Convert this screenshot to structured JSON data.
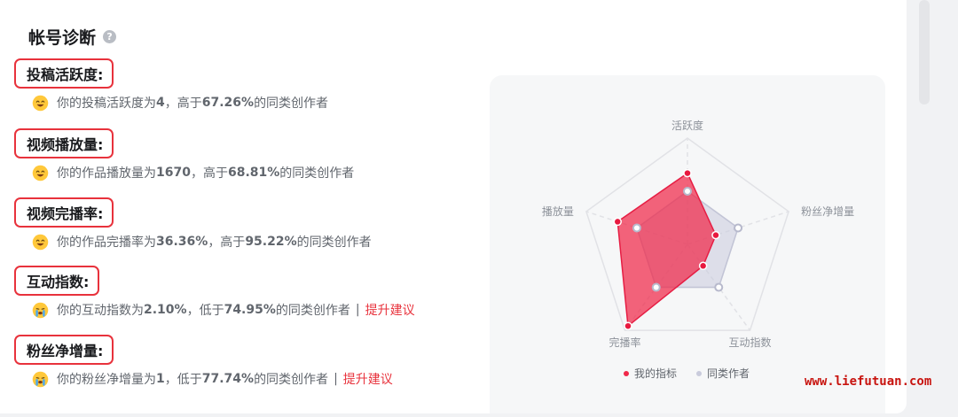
{
  "page": {
    "title": "帐号诊断",
    "help_icon": "?",
    "watermark": "www.liefutuan.com"
  },
  "metrics": [
    {
      "name": "投稿活跃度:",
      "mood": "happy",
      "prefix": "你的投稿活跃度为",
      "value": "4",
      "compare_word": "，高于",
      "percent": "67.26%",
      "suffix": "的同类创作者",
      "link": ""
    },
    {
      "name": "视频播放量:",
      "mood": "happy",
      "prefix": "你的作品播放量为",
      "value": "1670",
      "compare_word": "，高于",
      "percent": "68.81%",
      "suffix": "的同类创作者",
      "link": ""
    },
    {
      "name": "视频完播率:",
      "mood": "happy",
      "prefix": "你的作品完播率为",
      "value": "36.36%",
      "compare_word": "，高于",
      "percent": "95.22%",
      "suffix": "的同类创作者",
      "link": ""
    },
    {
      "name": "互动指数:",
      "mood": "crying",
      "prefix": "你的互动指数为",
      "value": "2.10%",
      "compare_word": "，低于",
      "percent": "74.95%",
      "suffix": "的同类创作者",
      "separator": "|",
      "link": "提升建议"
    },
    {
      "name": "粉丝净增量:",
      "mood": "crying",
      "prefix": "你的粉丝净增量为",
      "value": "1",
      "compare_word": "，低于",
      "percent": "77.74%",
      "suffix": "的同类创作者",
      "separator": "|",
      "link": "提升建议"
    }
  ],
  "chart_data": {
    "type": "radar",
    "axes": [
      "活跃度",
      "粉丝净增量",
      "互动指数",
      "完播率",
      "播放量"
    ],
    "max": 1.0,
    "series": [
      {
        "name": "我的指标",
        "color": "#f0284a",
        "values": [
          0.67,
          0.28,
          0.25,
          0.95,
          0.69
        ]
      },
      {
        "name": "同类作者",
        "color": "#c9cbdc",
        "values": [
          0.5,
          0.5,
          0.5,
          0.5,
          0.5
        ]
      }
    ],
    "legend": {
      "items": [
        "我的指标",
        "同类作者"
      ],
      "position": "bottom"
    },
    "grid": true
  }
}
